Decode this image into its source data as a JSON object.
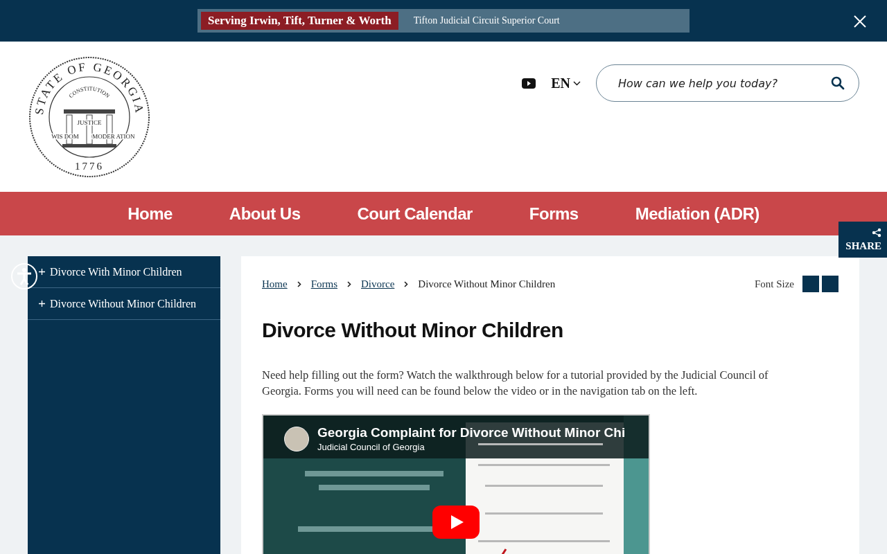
{
  "alert_bar": {
    "badge": "Serving Irwin, Tift, Turner & Worth",
    "text": "Tifton Judicial Circuit Superior Court"
  },
  "seal": {
    "ring_text": "STATE OF GEORGIA",
    "arch_text": "CONSTITUTION",
    "motto": [
      "JUSTICE",
      "WIS DOM",
      "MODER ATION"
    ],
    "year": "1776"
  },
  "language": {
    "label": "EN"
  },
  "search": {
    "placeholder": "How can we help you today?"
  },
  "nav": [
    {
      "label": "Home"
    },
    {
      "label": "About Us"
    },
    {
      "label": "Court Calendar"
    },
    {
      "label": "Forms"
    },
    {
      "label": "Mediation (ADR)"
    }
  ],
  "share": {
    "label": "SHARE"
  },
  "sidebar": {
    "items": [
      {
        "label": "Divorce With Minor Children",
        "expanded": false
      },
      {
        "label": "Divorce Without Minor Children",
        "expanded": false
      }
    ]
  },
  "breadcrumb": [
    {
      "label": "Home",
      "kind": "link"
    },
    {
      "label": "Forms",
      "kind": "link"
    },
    {
      "label": "Divorce",
      "kind": "link"
    },
    {
      "label": "Divorce Without Minor Children",
      "kind": "current"
    }
  ],
  "font_size": {
    "label": "Font Size"
  },
  "title": "Divorce Without Minor Children",
  "intro": "Need help filling out the form? Watch the walkthrough below for a tutorial provided by the Judicial Council of Georgia. Forms you will need can be found below the video or in the navigation tab on the left.",
  "video": {
    "title": "Georgia Complaint for Divorce Without Minor Chi",
    "channel": "Judicial Council of Georgia",
    "kind": "picture"
  }
}
